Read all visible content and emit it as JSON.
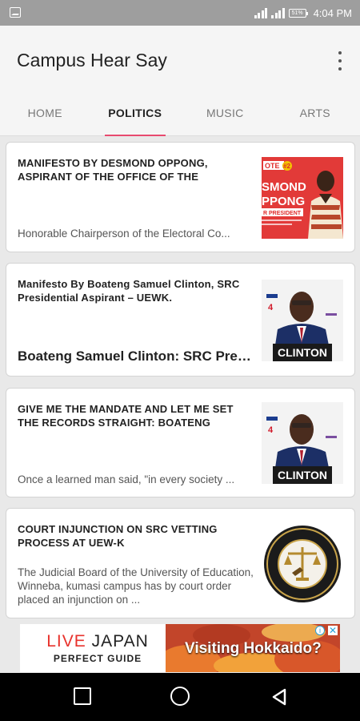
{
  "status_bar": {
    "time": "4:04 PM",
    "battery": "51%"
  },
  "app": {
    "title": "Campus Hear Say"
  },
  "tabs": [
    {
      "label": "HOME"
    },
    {
      "label": "POLITICS",
      "active": true
    },
    {
      "label": "MUSIC"
    },
    {
      "label": "ARTS"
    }
  ],
  "articles": [
    {
      "title": "MANIFESTO BY DESMOND OPPONG, ASPIRANT OF THE OFFICE OF THE",
      "snippet": "Honorable Chairperson of the Electoral Co..."
    },
    {
      "title": "Manifesto By Boateng Samuel Clinton, SRC Presidential Aspirant – UEWK.",
      "snippet": "Boateng Samuel Clinton: SRC Presid..."
    },
    {
      "title": "GIVE ME THE MANDATE AND LET ME SET THE RECORDS STRAIGHT: BOATENG",
      "snippet": "Once a learned man said, \"in every society ..."
    },
    {
      "title": "COURT INJUNCTION ON SRC VETTING PROCESS AT UEW-K",
      "snippet": "The Judicial Board of the University of Education, Winneba, kumasi campus has by court order placed an injunction on ..."
    }
  ],
  "thumbs": {
    "desmond": {
      "top": "OTE",
      "num": "#2",
      "name1": "SMOND",
      "name2": "PPONG",
      "role": "R PRESIDENT"
    },
    "clinton": {
      "name": "CLINTON"
    }
  },
  "ad": {
    "brand_red": "LIVE",
    "brand_rest": "JAPAN",
    "sub": "PERFECT GUIDE",
    "headline": "Visiting Hokkaido?"
  },
  "colors": {
    "accent": "#e84a6f",
    "ad_red": "#e8322c"
  }
}
